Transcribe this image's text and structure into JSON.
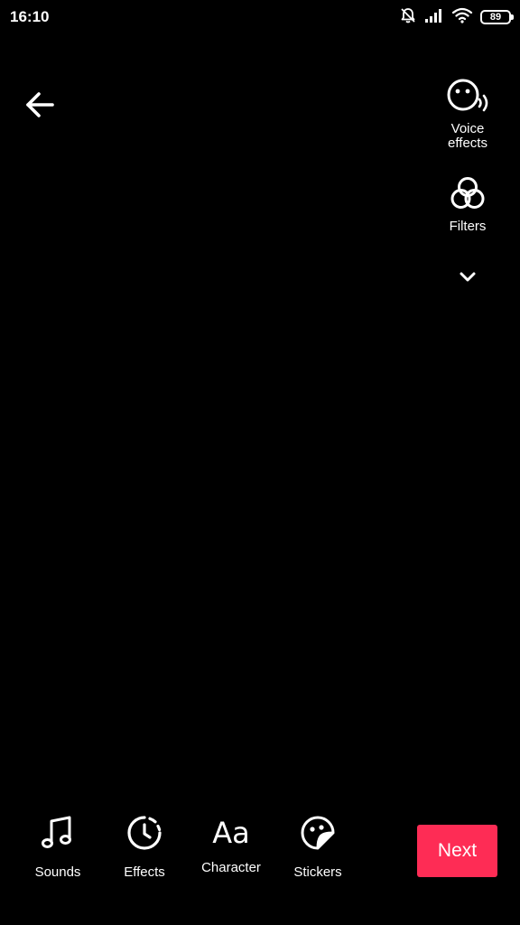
{
  "status_bar": {
    "time": "16:10",
    "battery": "89",
    "icons": [
      "notifications-off-icon",
      "signal-icon",
      "wifi-icon",
      "battery-icon"
    ]
  },
  "top": {
    "back_icon": "arrow-left-icon"
  },
  "right_rail": {
    "voice_effects": {
      "label_line1": "Voice",
      "label_line2": "effects",
      "icon": "voice-effects-icon"
    },
    "filters": {
      "label": "Filters",
      "icon": "filters-icon"
    },
    "more": {
      "icon": "chevron-down-icon"
    }
  },
  "toolbar": {
    "items": [
      {
        "label": "Sounds",
        "icon": "music-note-icon"
      },
      {
        "label": "Effects",
        "icon": "effects-clock-icon"
      },
      {
        "label": "Character",
        "icon": "text-aa-icon",
        "glyph": "Aa"
      },
      {
        "label": "Stickers",
        "icon": "sticker-face-icon"
      }
    ],
    "next_label": "Next"
  },
  "colors": {
    "background": "#000000",
    "text": "#ffffff",
    "accent": "#fe2c55"
  }
}
